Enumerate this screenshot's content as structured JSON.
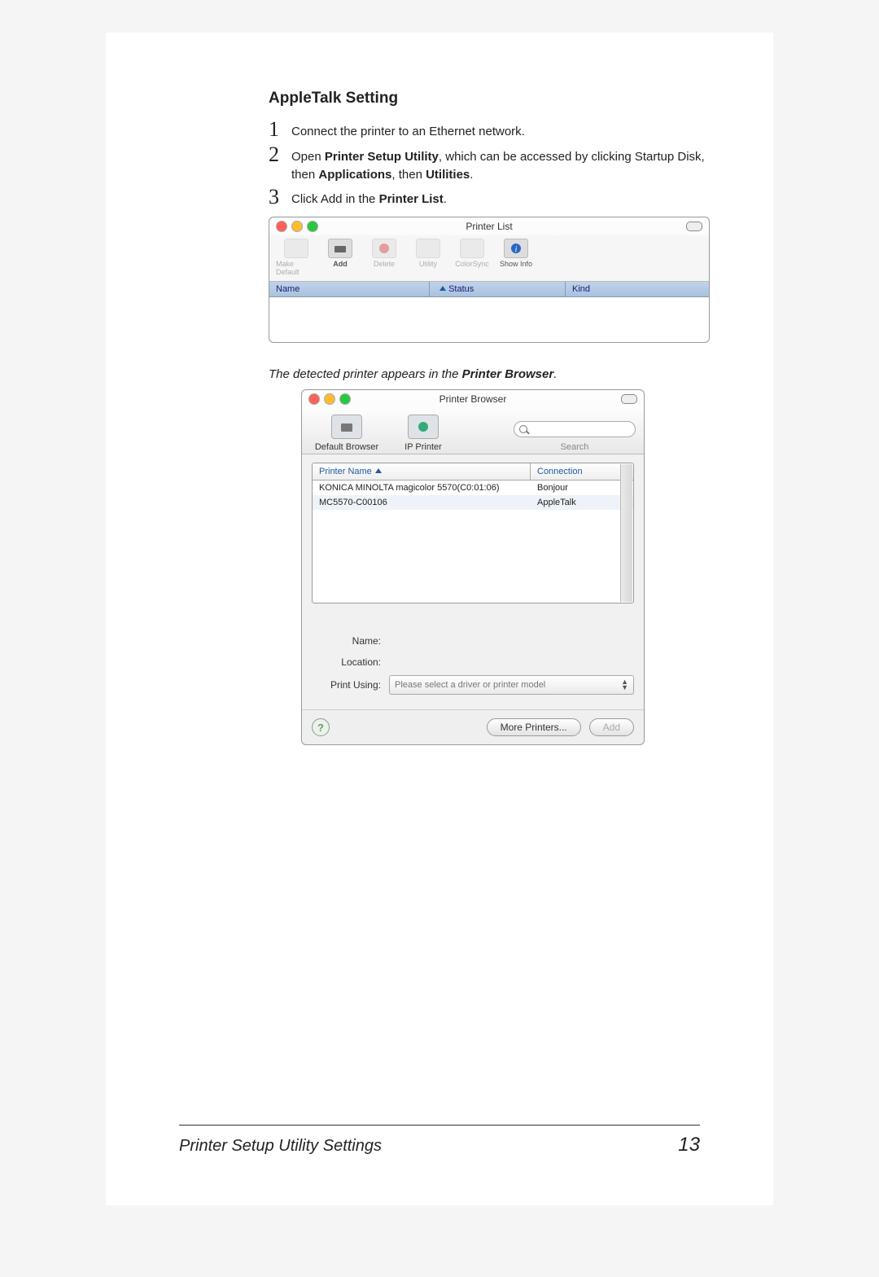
{
  "section_title": "AppleTalk Setting",
  "steps": {
    "s1": {
      "num": "1",
      "text": "Connect the printer to an Ethernet network."
    },
    "s2": {
      "num": "2",
      "pre": "Open ",
      "b1": "Printer Setup Utility",
      "mid": ", which can be accessed by clicking Startup Disk, then ",
      "b2": "Applications",
      "mid2": ", then ",
      "b3": "Utilities",
      "post": "."
    },
    "s3": {
      "num": "3",
      "pre": "Click Add in the ",
      "b1": "Printer List",
      "post": "."
    }
  },
  "printer_list_window": {
    "title": "Printer List",
    "toolbar": {
      "make_default": "Make Default",
      "add": "Add",
      "delete": "Delete",
      "utility": "Utility",
      "colorsync": "ColorSync",
      "show_info": "Show Info"
    },
    "cols": {
      "name": "Name",
      "status": "Status",
      "kind": "Kind"
    }
  },
  "caption_pre": "The detected printer appears in the ",
  "caption_bold": "Printer Browser",
  "caption_post": ".",
  "printer_browser_window": {
    "title": "Printer Browser",
    "tabs": {
      "default": "Default Browser",
      "ip": "IP Printer"
    },
    "search_label": "Search",
    "search_placeholder": "",
    "list_cols": {
      "name": "Printer Name",
      "conn": "Connection"
    },
    "rows": [
      {
        "name": "KONICA MINOLTA magicolor 5570(C0:01:06)",
        "conn": "Bonjour"
      },
      {
        "name": "MC5570-C00106",
        "conn": "AppleTalk"
      }
    ],
    "fields": {
      "name_label": "Name:",
      "location_label": "Location:",
      "print_using_label": "Print Using:",
      "print_using_value": "Please select a driver or printer model"
    },
    "buttons": {
      "more": "More Printers...",
      "add": "Add",
      "help": "?"
    }
  },
  "footer": {
    "title": "Printer Setup Utility Settings",
    "page": "13"
  }
}
